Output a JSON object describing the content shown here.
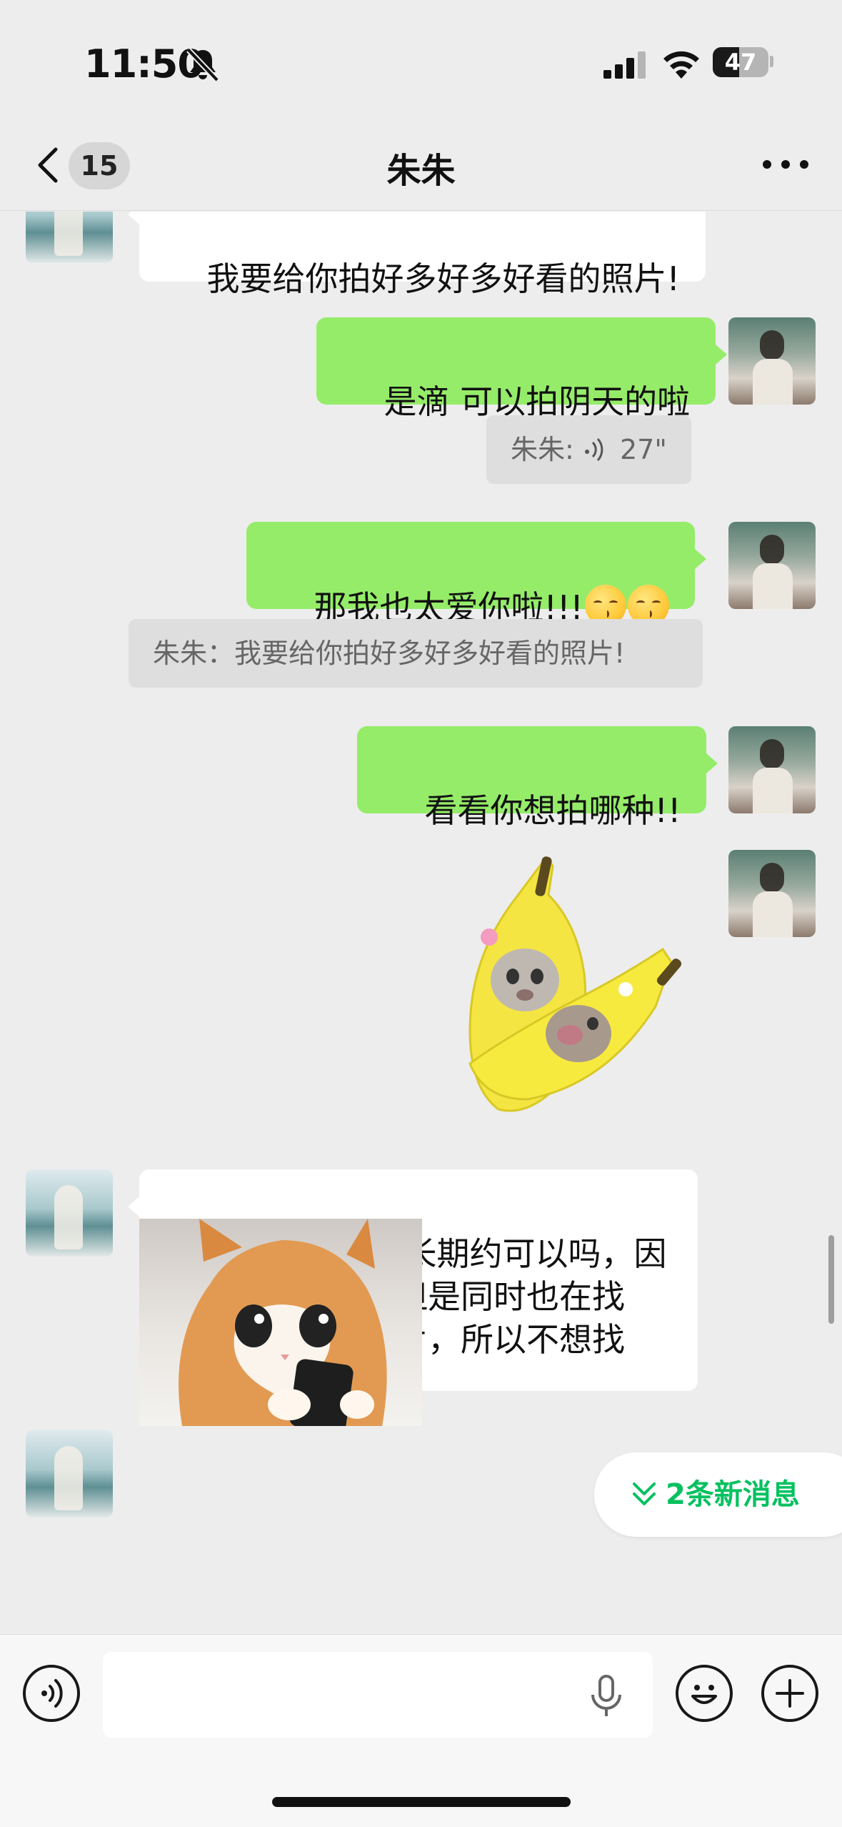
{
  "status_bar": {
    "time": "11:50",
    "battery": "47",
    "battery_level": 0.47
  },
  "nav": {
    "unread_count": "15",
    "title": "朱朱"
  },
  "messages": {
    "m1": "我要给你拍好多好多好看的照片!",
    "m2": "是滴 可以拍阴天的啦",
    "m2_quote": "朱朱: ",
    "m2_quote_duration": "27\"",
    "m3": "那我也太爱你啦!!!",
    "m3_quote": "朱朱：我要给你拍好多好多好看的照片!",
    "m4": "看看你想拍哪种!!",
    "m5": "宝宝我们以后长期约可以吗，因\n为我现在收费，但是同时也在找\n少量互勉来出样片，所以不想找\n别的不熟悉人了"
  },
  "new_messages": {
    "label": "2条新消息"
  },
  "input": {
    "value": "",
    "placeholder": ""
  },
  "colors": {
    "self_bubble": "#95ec69",
    "peer_bubble": "#ffffff",
    "accent": "#07c160",
    "background": "#ededed"
  },
  "icons": [
    "bell-muted-icon",
    "signal-icon",
    "wifi-icon",
    "battery-icon",
    "back-chevron-icon",
    "more-icon",
    "voice-mode-icon",
    "mic-icon",
    "emoji-icon",
    "plus-icon",
    "chevrons-down-icon"
  ]
}
